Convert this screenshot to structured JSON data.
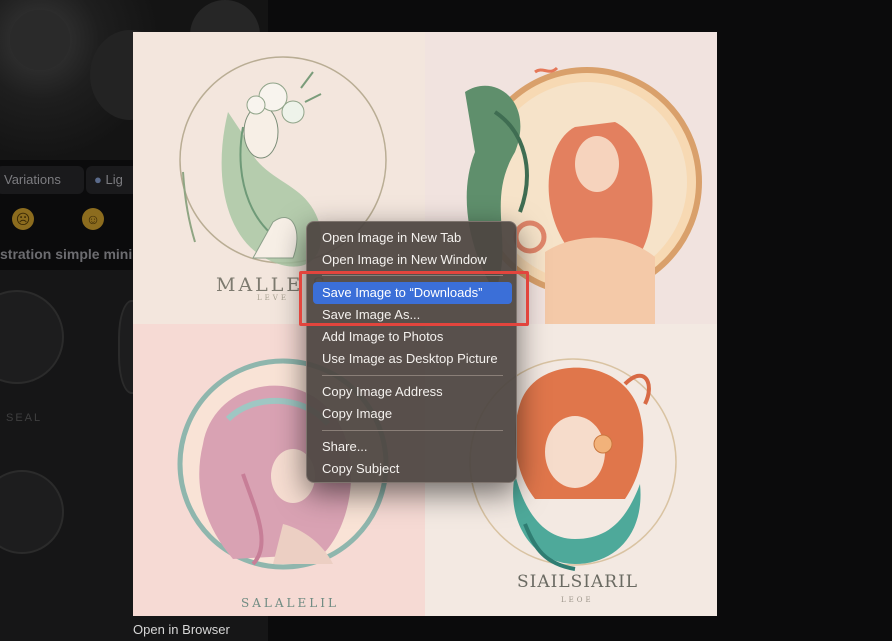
{
  "background": {
    "toolbar": {
      "variations_label": "Variations",
      "light_label": "Lig"
    },
    "prompt_text": "stration simple mini",
    "grid_seal_text": "SEAL",
    "open_in_browser": "Open in Browser"
  },
  "preview": {
    "quadrants": [
      {
        "caption": "MALLE S",
        "subcaption": "LEVE"
      },
      {
        "caption": ""
      },
      {
        "caption": "SALALELIL"
      },
      {
        "caption": "SIAILSIARIL",
        "subcaption": "LEOE"
      }
    ]
  },
  "context_menu": {
    "items": [
      {
        "label": "Open Image in New Tab",
        "selected": false
      },
      {
        "label": "Open Image in New Window",
        "selected": false
      },
      {
        "label": "Save Image to “Downloads”",
        "selected": true
      },
      {
        "label": "Save Image As...",
        "selected": false
      },
      {
        "label": "Add Image to Photos",
        "selected": false
      },
      {
        "label": "Use Image as Desktop Picture",
        "selected": false
      },
      {
        "label": "Copy Image Address",
        "selected": false
      },
      {
        "label": "Copy Image",
        "selected": false
      },
      {
        "label": "Share...",
        "selected": false
      },
      {
        "label": "Copy Subject",
        "selected": false
      }
    ],
    "selected_color": "#3b6fd8"
  },
  "annotation": {
    "highlight_color": "#e2453d"
  }
}
